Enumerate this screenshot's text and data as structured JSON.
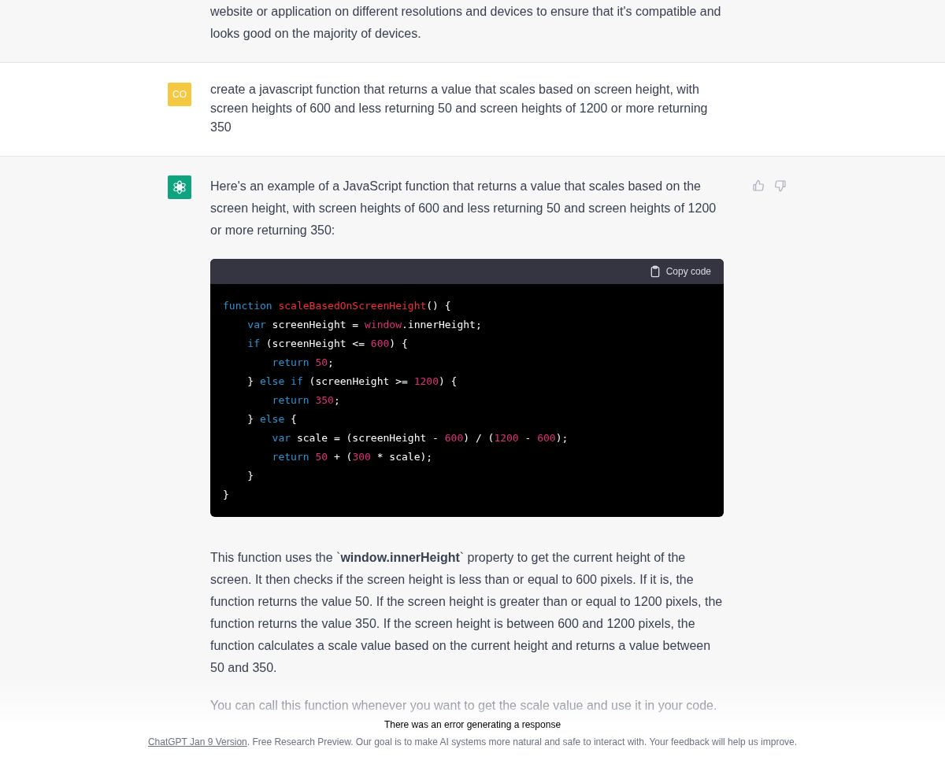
{
  "messages": [
    {
      "kind": "continuation",
      "paragraphs": [
        "website or application on different resolutions and devices to ensure that it's compatible and looks good on the majority of devices."
      ]
    },
    {
      "kind": "user",
      "avatar": "CO",
      "paragraphs": [
        "create a javascript function that returns a value that scales based on screen height, with screen heights of 600 and less returning 50 and screen heights of 1200 or more returning 350"
      ]
    },
    {
      "kind": "assistant",
      "feedback": true,
      "paragraphs": [
        "Here's an example of a JavaScript function that returns a value that scales based on the screen height, with screen heights of 600 and less returning 50 and screen heights of 1200 or more returning 350:"
      ],
      "code": {
        "copy_label": "Copy code",
        "lines": [
          [
            {
              "kind": "keyword",
              "text": "function "
            },
            {
              "kind": "title",
              "text": "scaleBasedOnScreenHeight"
            },
            {
              "kind": "plain",
              "text": "() {"
            }
          ],
          [
            {
              "kind": "keyword",
              "text": "    var"
            },
            {
              "kind": "plain",
              "text": " screenHeight = "
            },
            {
              "kind": "builtin",
              "text": "window"
            },
            {
              "kind": "plain",
              "text": ".innerHeight;"
            }
          ],
          [
            {
              "kind": "keyword",
              "text": "    if"
            },
            {
              "kind": "plain",
              "text": " (screenHeight <= "
            },
            {
              "kind": "number",
              "text": "600"
            },
            {
              "kind": "plain",
              "text": ") {"
            }
          ],
          [
            {
              "kind": "keyword",
              "text": "        return "
            },
            {
              "kind": "number",
              "text": "50"
            },
            {
              "kind": "plain",
              "text": ";"
            }
          ],
          [
            {
              "kind": "plain",
              "text": "    } "
            },
            {
              "kind": "keyword",
              "text": "else if"
            },
            {
              "kind": "plain",
              "text": " (screenHeight >= "
            },
            {
              "kind": "number",
              "text": "1200"
            },
            {
              "kind": "plain",
              "text": ") {"
            }
          ],
          [
            {
              "kind": "keyword",
              "text": "        return "
            },
            {
              "kind": "number",
              "text": "350"
            },
            {
              "kind": "plain",
              "text": ";"
            }
          ],
          [
            {
              "kind": "plain",
              "text": "    } "
            },
            {
              "kind": "keyword",
              "text": "else"
            },
            {
              "kind": "plain",
              "text": " {"
            }
          ],
          [
            {
              "kind": "keyword",
              "text": "        var"
            },
            {
              "kind": "plain",
              "text": " scale = (screenHeight - "
            },
            {
              "kind": "number",
              "text": "600"
            },
            {
              "kind": "plain",
              "text": ") / ("
            },
            {
              "kind": "number",
              "text": "1200"
            },
            {
              "kind": "plain",
              "text": " - "
            },
            {
              "kind": "number",
              "text": "600"
            },
            {
              "kind": "plain",
              "text": ");"
            }
          ],
          [
            {
              "kind": "keyword",
              "text": "        return "
            },
            {
              "kind": "number",
              "text": "50"
            },
            {
              "kind": "plain",
              "text": " + ("
            },
            {
              "kind": "number",
              "text": "300"
            },
            {
              "kind": "plain",
              "text": " * scale);"
            }
          ],
          [
            {
              "kind": "plain",
              "text": "    }"
            }
          ],
          [
            {
              "kind": "plain",
              "text": "}"
            }
          ]
        ]
      },
      "after": [
        "This function uses the `**window.innerHeight**` property to get the current height of the screen. It then checks if the screen height is less than or equal to 600 pixels. If it is, the function returns the value 50. If the screen height is greater than or equal to 1200 pixels, the function returns the value 350. If the screen height is between 600 and 1200 pixels, the function calculates a scale value based on the current height and returns a value between 50 and 350.",
        "You can call this function whenever you want to get the scale value and use it in your code."
      ]
    }
  ],
  "error": "There was an error generating a response",
  "footer": {
    "link": "ChatGPT Jan 9 Version",
    "text": ". Free Research Preview. Our goal is to make AI systems more natural and safe to interact with. Your feedback will help us improve."
  }
}
